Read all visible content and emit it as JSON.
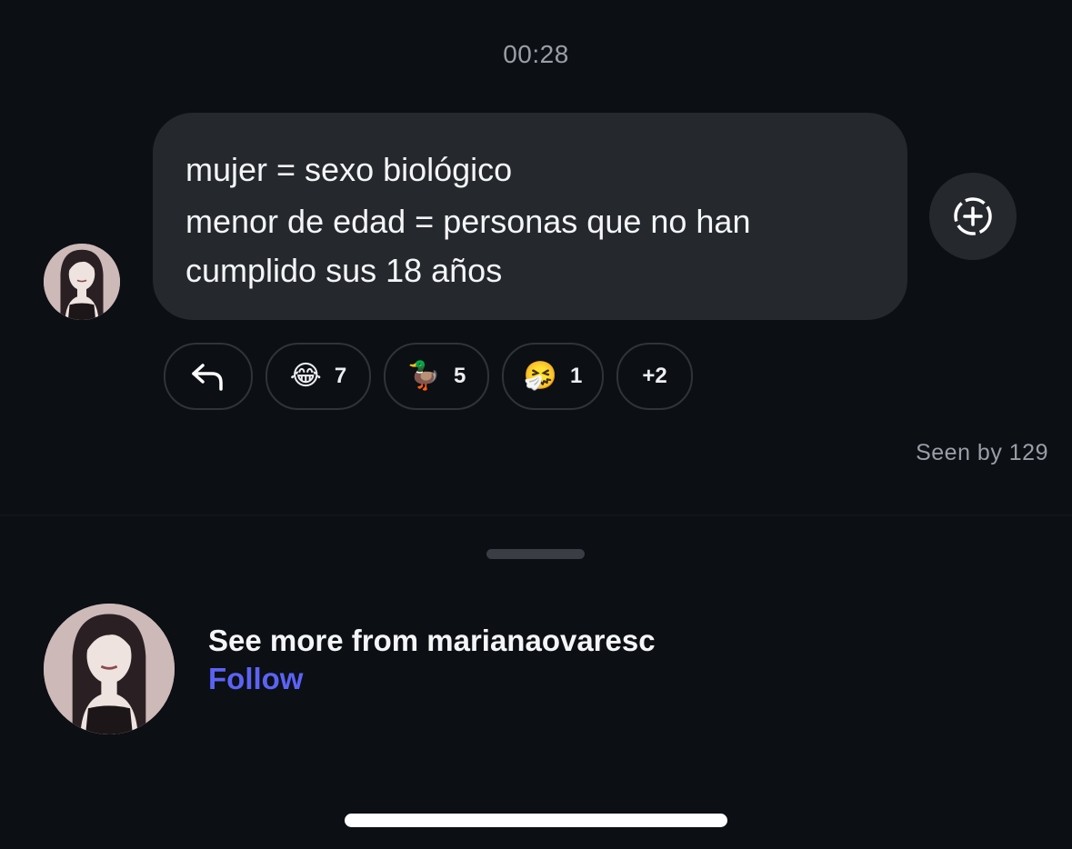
{
  "timestamp": "00:28",
  "message": {
    "line1": "mujer = sexo biológico",
    "line2": "menor de edad = personas que no han cumplido sus 18 años"
  },
  "reactions": {
    "reply_icon": "reply-arrow-icon",
    "items": [
      {
        "emoji": "😂",
        "icon": "laughing-tears-emoji",
        "count": "7"
      },
      {
        "emoji": "🦆",
        "icon": "duck-emoji",
        "count": "5"
      },
      {
        "emoji": "🤧",
        "icon": "sneezing-face-emoji",
        "count": "1"
      }
    ],
    "more": "+2"
  },
  "add_reaction_icon": "add-reaction-icon",
  "seen_text": "Seen by 129",
  "profile": {
    "see_more": "See more from marianaovaresc",
    "follow_label": "Follow"
  },
  "colors": {
    "background": "#0c0f14",
    "bubble": "#25282d",
    "follow": "#5b63f5",
    "muted_text": "#9a9ea6"
  }
}
